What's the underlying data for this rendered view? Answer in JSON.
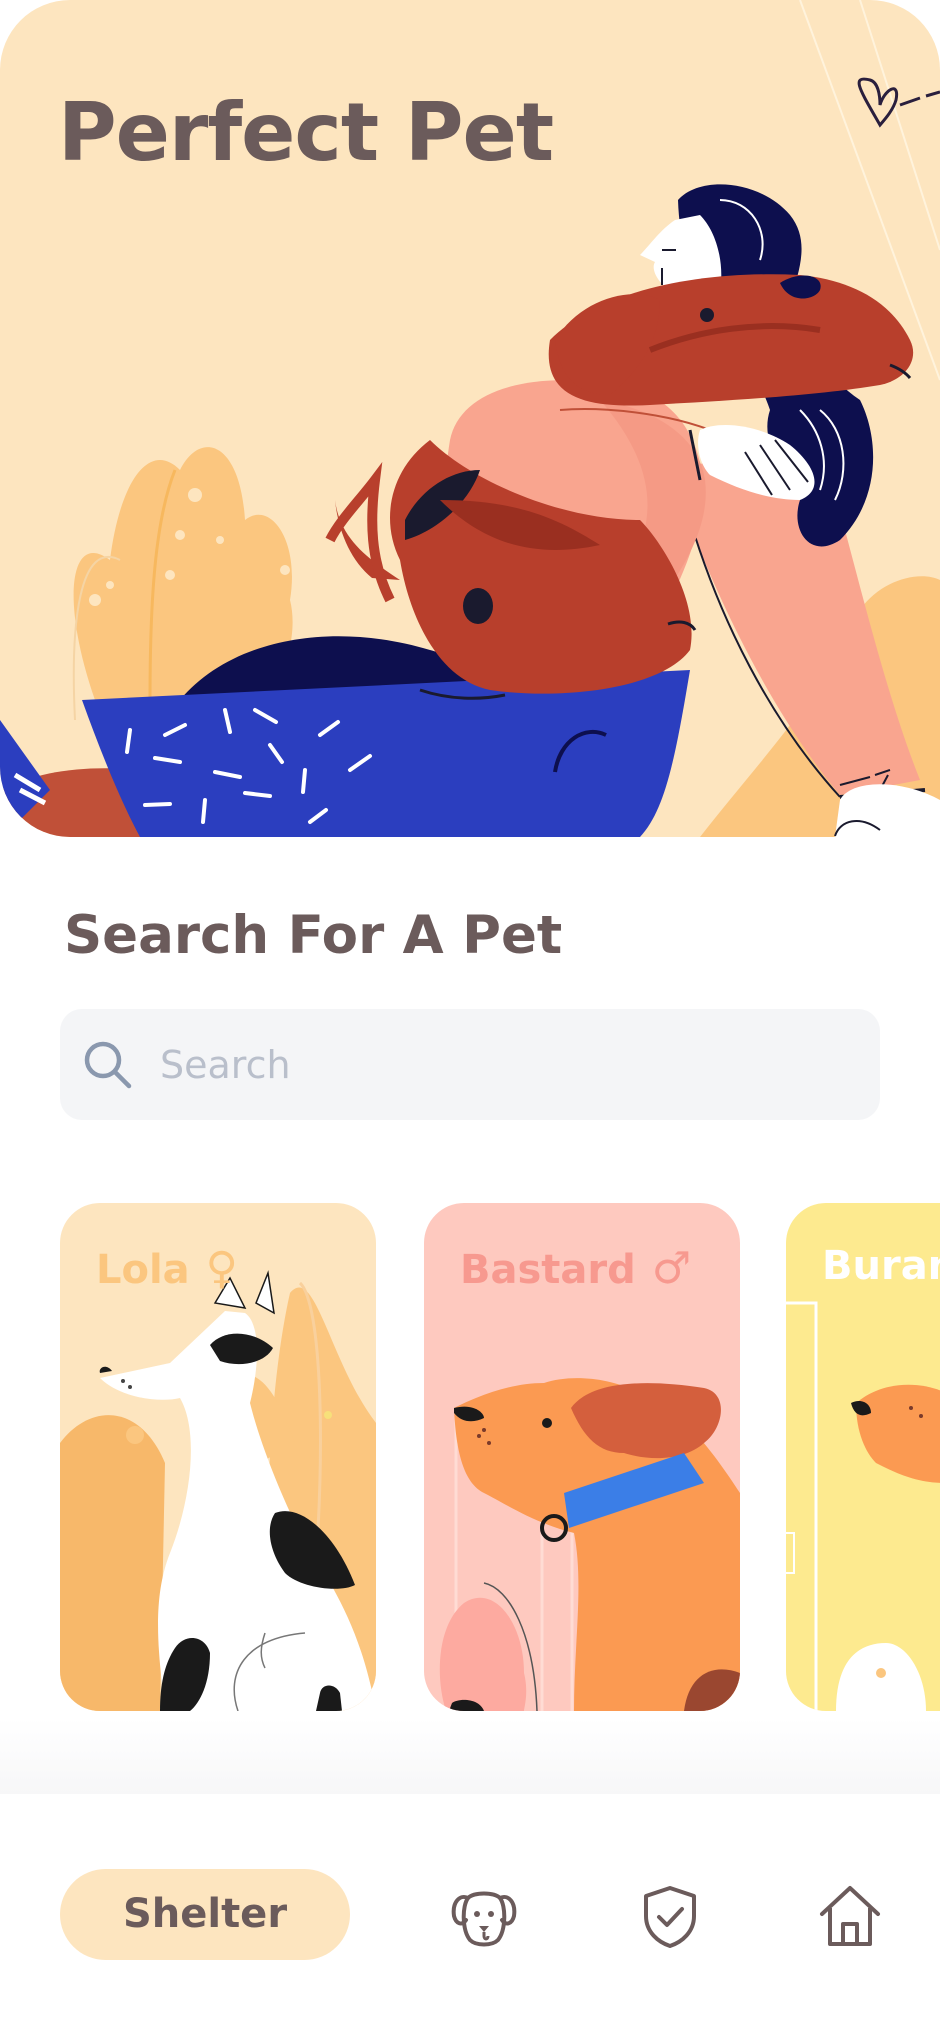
{
  "hero": {
    "title": "Perfect Pet"
  },
  "search": {
    "section_title": "Search For A Pet",
    "placeholder": "Search",
    "value": ""
  },
  "pets": [
    {
      "name": "Lola",
      "gender_symbol": "♀",
      "card_color": "#fde5bf",
      "text_color": "#fbc67f"
    },
    {
      "name": "Bastard",
      "gender_symbol": "♂",
      "card_color": "#fec9bf",
      "text_color": "#f7998f"
    },
    {
      "name": "Buran",
      "gender_symbol": "",
      "card_color": "#fdea8f",
      "text_color": "#ffffff"
    }
  ],
  "nav": {
    "active_label": "Shelter",
    "icons": [
      "dog-icon",
      "shield-check-icon",
      "home-icon"
    ]
  },
  "colors": {
    "primary_text": "#6b5b5b",
    "hero_bg": "#fde5bf",
    "search_bg": "#f4f5f7",
    "placeholder": "#b9bfcb"
  }
}
